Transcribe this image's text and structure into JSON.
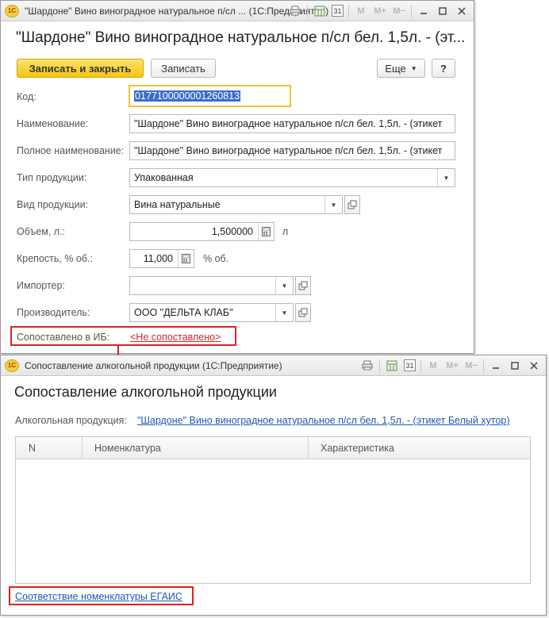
{
  "window1": {
    "title": "\"Шардоне\" Вино виноградное натуральное п/сл ...  (1С:Предприятие)",
    "heading": "\"Шардоне\" Вино виноградное натуральное п/сл бел. 1,5л. - (эт...",
    "toolbar": {
      "save_close": "Записать и закрыть",
      "save": "Записать",
      "more": "Еще",
      "help": "?"
    },
    "title_icons": [
      "print-icon",
      "calendar-grid-icon",
      "calendar-icon",
      "memory-m-icon",
      "memory-mplus-icon",
      "memory-mminus-icon",
      "minimize-icon",
      "maximize-icon",
      "close-icon"
    ],
    "title_icon_text": {
      "m": "M",
      "mplus": "M+",
      "mminus": "M−",
      "cal": "31"
    },
    "fields": {
      "kod": {
        "label": "Код:",
        "value": "0177100000001260813"
      },
      "name": {
        "label": "Наименование:",
        "value": "\"Шардоне\" Вино виноградное натуральное п/сл бел. 1,5л. - (этикет"
      },
      "full_name": {
        "label": "Полное наименование:",
        "value": "\"Шардоне\" Вино виноградное натуральное п/сл бел. 1,5л. - (этикет"
      },
      "type": {
        "label": "Тип продукции:",
        "value": "Упакованная"
      },
      "kind": {
        "label": "Вид продукции:",
        "value": "Вина натуральные"
      },
      "volume": {
        "label": "Объем, л.:",
        "value": "1,500000",
        "unit": "л"
      },
      "strength": {
        "label": "Крепость, % об.:",
        "value": "11,000",
        "unit": "% об."
      },
      "importer": {
        "label": "Импортер:",
        "value": ""
      },
      "producer": {
        "label": "Производитель:",
        "value": "ООО \"ДЕЛЬТА КЛАБ\""
      },
      "matched": {
        "label": "Сопоставлено в ИБ:",
        "link": "<Не сопоставлено>"
      }
    }
  },
  "window2": {
    "title": "Сопоставление алкогольной продукции  (1С:Предприятие)",
    "heading": "Сопоставление алкогольной продукции",
    "product_label": "Алкогольная продукция:",
    "product_link": "\"Шардоне\" Вино виноградное натуральное п/сл бел. 1,5л. - (этикет Белый хутор)",
    "columns": [
      "N",
      "Номенклатура",
      "Характеристика"
    ],
    "rows": [],
    "footer_link": "Соответствие номенклатуры ЕГАИС"
  },
  "colors": {
    "accent_yellow": "#f3c614",
    "link_blue": "#1e58b0",
    "highlight_red": "#e01f1f"
  }
}
